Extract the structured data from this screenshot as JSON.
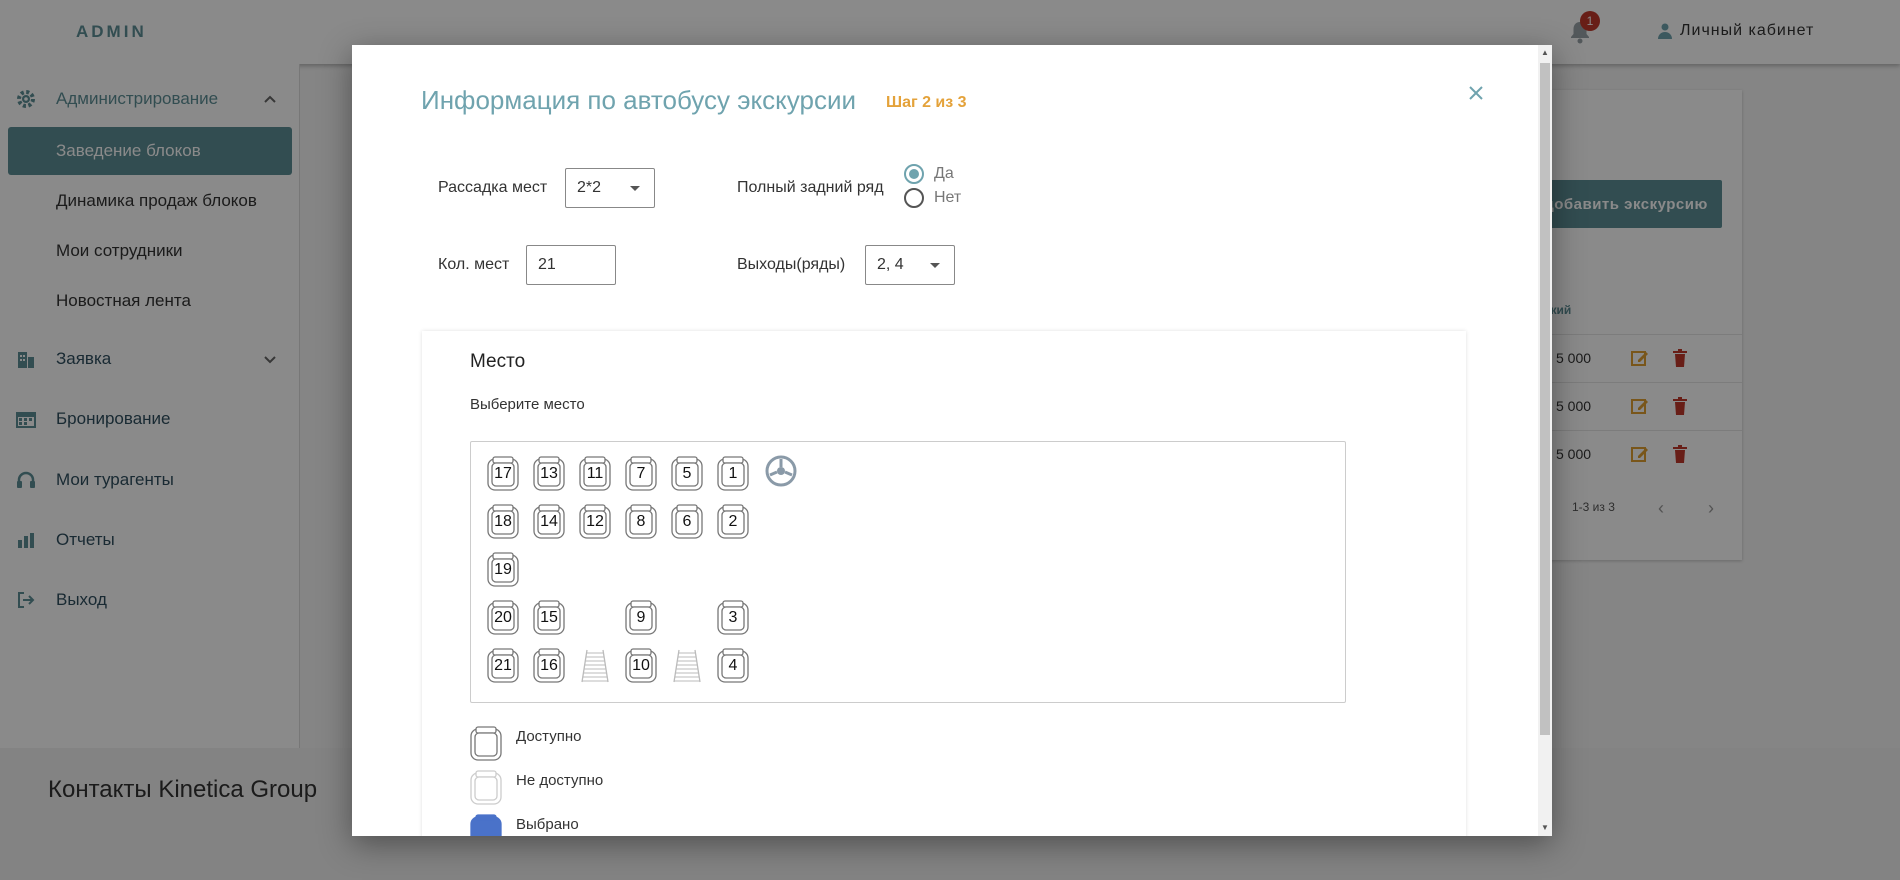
{
  "app": {
    "logo": "ADMIN",
    "notifications_count": "1",
    "cabinet_label": "Личный кабинет"
  },
  "sidebar": {
    "sections": [
      {
        "label": "Администрирование",
        "icon": "gear-icon",
        "expanded": true
      },
      {
        "label": "Заявка",
        "icon": "building-icon",
        "expanded": false
      },
      {
        "label": "Бронирование",
        "icon": "calendar-icon"
      },
      {
        "label": "Мои турагенты",
        "icon": "headset-icon"
      },
      {
        "label": "Отчеты",
        "icon": "bar-chart-icon"
      },
      {
        "label": "Выход",
        "icon": "logout-icon"
      }
    ],
    "admin_items": [
      "Заведение блоков",
      "Динамика продаж блоков",
      "Мои сотрудники",
      "Новостная лента"
    ],
    "active_item": "Заведение блоков"
  },
  "footer": {
    "title": "Контакты Kinetica Group"
  },
  "background_table": {
    "add_button": "добавить экскурсию",
    "column_header_fragment": "жий",
    "rows": [
      {
        "price": "5 000"
      },
      {
        "price": "5 000"
      },
      {
        "price": "5 000"
      }
    ],
    "pagination": "1-3 из 3"
  },
  "modal": {
    "title": "Информация по автобусу экскурсии",
    "step": "Шаг 2 из 3",
    "form": {
      "seating_label": "Рассадка мест",
      "seating_value": "2*2",
      "full_back_row_label": "Полный задний ряд",
      "radio_yes": "Да",
      "radio_no": "Нет",
      "full_back_row_selected": "Да",
      "seats_count_label": "Кол. мест",
      "seats_count_value": "21",
      "exits_label": "Выходы(ряды)",
      "exits_value": "2, 4"
    },
    "seat_map": {
      "title": "Место",
      "subtitle": "Выберите место",
      "rows": [
        [
          "17",
          "13",
          "11",
          "7",
          "5",
          "1",
          "wheel"
        ],
        [
          "18",
          "14",
          "12",
          "8",
          "6",
          "2"
        ],
        [
          "19"
        ],
        [
          "20",
          "15",
          "",
          "9",
          "",
          "3"
        ],
        [
          "21",
          "16",
          "stairs",
          "10",
          "stairs",
          "4"
        ]
      ],
      "legend": [
        {
          "label": "Доступно",
          "state": "available"
        },
        {
          "label": "Не доступно",
          "state": "unavailable"
        },
        {
          "label": "Выбрано",
          "state": "selected"
        }
      ]
    }
  },
  "colors": {
    "accent": "#5d8f96",
    "title": "#6fa3ae",
    "step": "#e4a23a",
    "selected_seat": "#4a72c9",
    "danger": "#c0392b",
    "edit": "#e0a030"
  }
}
